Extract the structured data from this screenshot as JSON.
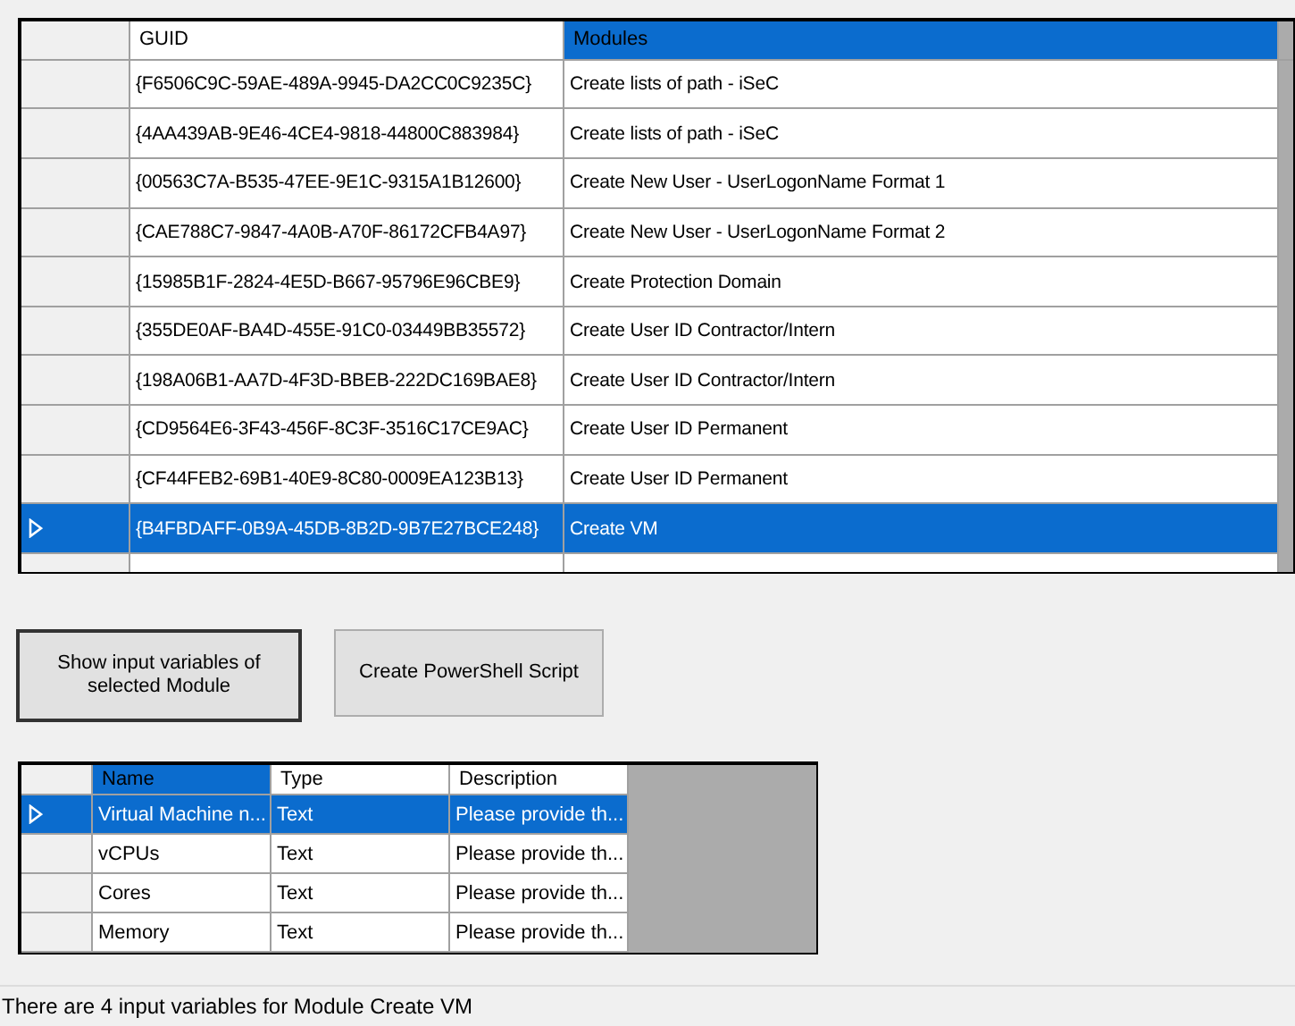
{
  "modules_grid": {
    "columns": [
      {
        "label": "GUID",
        "selected": false
      },
      {
        "label": "Modules",
        "selected": true
      }
    ],
    "rows": [
      {
        "cells": [
          "{F6506C9C-59AE-489A-9945-DA2CC0C9235C}",
          "Create lists of path - iSeC"
        ],
        "selected": false
      },
      {
        "cells": [
          "{4AA439AB-9E46-4CE4-9818-44800C883984}",
          "Create lists of path - iSeC"
        ],
        "selected": false
      },
      {
        "cells": [
          "{00563C7A-B535-47EE-9E1C-9315A1B12600}",
          "Create New User - UserLogonName Format 1"
        ],
        "selected": false
      },
      {
        "cells": [
          "{CAE788C7-9847-4A0B-A70F-86172CFB4A97}",
          "Create New User - UserLogonName Format 2"
        ],
        "selected": false
      },
      {
        "cells": [
          "{15985B1F-2824-4E5D-B667-95796E96CBE9}",
          "Create Protection Domain"
        ],
        "selected": false
      },
      {
        "cells": [
          "{355DE0AF-BA4D-455E-91C0-03449BB35572}",
          "Create User ID Contractor/Intern"
        ],
        "selected": false
      },
      {
        "cells": [
          "{198A06B1-AA7D-4F3D-BBEB-222DC169BAE8}",
          "Create User ID Contractor/Intern"
        ],
        "selected": false
      },
      {
        "cells": [
          "{CD9564E6-3F43-456F-8C3F-3516C17CE9AC}",
          "Create User ID Permanent"
        ],
        "selected": false
      },
      {
        "cells": [
          "{CF44FEB2-69B1-40E9-8C80-0009EA123B13}",
          "Create User ID Permanent"
        ],
        "selected": false
      },
      {
        "cells": [
          "{B4FBDAFF-0B9A-45DB-8B2D-9B7E27BCE248}",
          "Create VM"
        ],
        "selected": true
      }
    ]
  },
  "buttons": [
    "Show input variables of selected Module",
    "Create PowerShell Script"
  ],
  "variables_grid": {
    "columns": [
      {
        "label": "Name",
        "selected": true
      },
      {
        "label": "Type",
        "selected": false
      },
      {
        "label": "Description",
        "selected": false
      }
    ],
    "rows": [
      {
        "cells": [
          "Virtual Machine n...",
          "Text",
          "Please provide th..."
        ],
        "selected": true
      },
      {
        "cells": [
          "vCPUs",
          "Text",
          "Please provide th..."
        ],
        "selected": false
      },
      {
        "cells": [
          "Cores",
          "Text",
          "Please provide th..."
        ],
        "selected": false
      },
      {
        "cells": [
          "Memory",
          "Text",
          "Please provide th..."
        ],
        "selected": false
      }
    ]
  },
  "status_bar": "There are 4 input variables for Module Create VM"
}
